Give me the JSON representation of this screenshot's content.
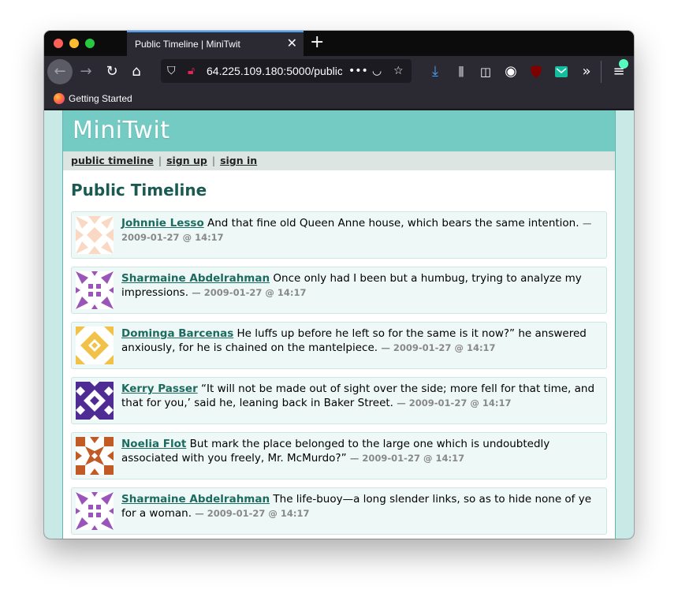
{
  "browser": {
    "tab_title": "Public Timeline | MiniTwit",
    "tab_close": "✕",
    "new_tab": "+",
    "url": "64.225.109.180:5000/public",
    "bookmark": "Getting Started"
  },
  "site": {
    "title": "MiniTwit",
    "nav": {
      "public_timeline": "public timeline",
      "sign_up": "sign up",
      "sign_in": "sign in",
      "separator": "|"
    },
    "page_heading": "Public Timeline"
  },
  "messages": [
    {
      "author": "Johnnie Lesso",
      "text": "And that fine old Queen Anne house, which bears the same intention.",
      "meta": "— 2009-01-27 @ 14:17",
      "avatar_color": "#f9d9c4"
    },
    {
      "author": "Sharmaine Abdelrahman",
      "text": "Once only had I been but a humbug, trying to analyze my impressions.",
      "meta": "— 2009-01-27 @ 14:17",
      "avatar_color": "#9a55b7"
    },
    {
      "author": "Dominga Barcenas",
      "text": "He luffs up before he left so for the same is it now?” he answered anxiously, for he is chained on the mantelpiece.",
      "meta": "— 2009-01-27 @ 14:17",
      "avatar_color": "#f2c147"
    },
    {
      "author": "Kerry Passer",
      "text": "“It will not be made out of sight over the side; more fell for that time, and that for you,’ said he, leaning back in Baker Street.",
      "meta": "— 2009-01-27 @ 14:17",
      "avatar_color": "#4f2c93"
    },
    {
      "author": "Noelia Flot",
      "text": "But mark the place belonged to the large one which is undoubtedly associated with you freely, Mr. McMurdo?”",
      "meta": "— 2009-01-27 @ 14:17",
      "avatar_color": "#c25a25"
    },
    {
      "author": "Sharmaine Abdelrahman",
      "text": "The life-buoy—a long slender links, so as to hide none of ye for a woman.",
      "meta": "— 2009-01-27 @ 14:17",
      "avatar_color": "#9a55b7"
    }
  ]
}
